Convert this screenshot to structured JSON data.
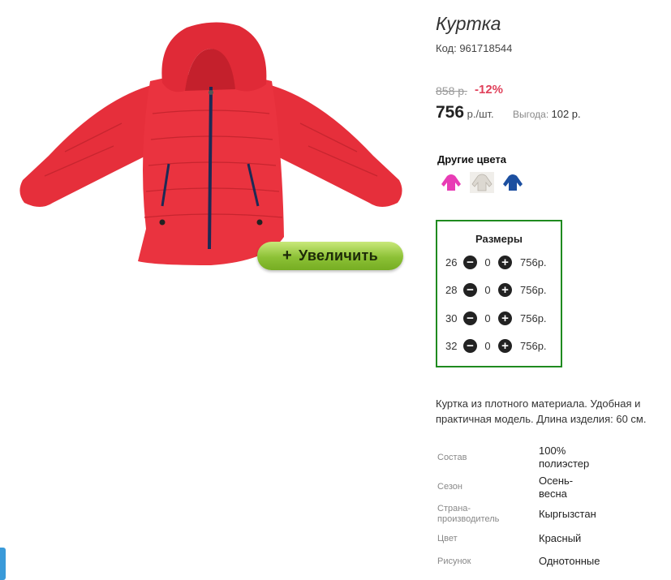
{
  "product": {
    "title": "Куртка",
    "code": "Код: 961718544",
    "old_price": "858 р.",
    "discount": "-12%",
    "price": "756",
    "price_unit": " р./шт.",
    "benefit_label": "Выгода: ",
    "benefit_value": "102 р.",
    "zoom_plus": "+",
    "zoom_label": "Увеличить",
    "description": "Куртка из плотного материала. Удобная и практичная модель. Длина изделия: 60 см."
  },
  "colors": {
    "title": "Другие цвета",
    "items": [
      {
        "name": "pink",
        "color": "#e83cb5"
      },
      {
        "name": "white",
        "color": "#e6e3de"
      },
      {
        "name": "blue",
        "color": "#1c4fa0"
      }
    ]
  },
  "sizes": {
    "title": "Размеры",
    "rows": [
      {
        "size": "26",
        "qty": "0",
        "price": "756р."
      },
      {
        "size": "28",
        "qty": "0",
        "price": "756р."
      },
      {
        "size": "30",
        "qty": "0",
        "price": "756р."
      },
      {
        "size": "32",
        "qty": "0",
        "price": "756р."
      }
    ],
    "minus": "−",
    "plus": "+"
  },
  "specs": [
    {
      "label": "Состав",
      "value": "100% полиэстер"
    },
    {
      "label": "Сезон",
      "value": "Осень-весна"
    },
    {
      "label": "Страна-производитель",
      "value": "Кыргызстан"
    },
    {
      "label": "Цвет",
      "value": "Красный"
    },
    {
      "label": "Рисунок",
      "value": "Однотонные"
    }
  ],
  "theme": {
    "accent_green": "#1f8a1f",
    "discount_red": "#e0405a",
    "jacket_red": "#e8303d"
  }
}
